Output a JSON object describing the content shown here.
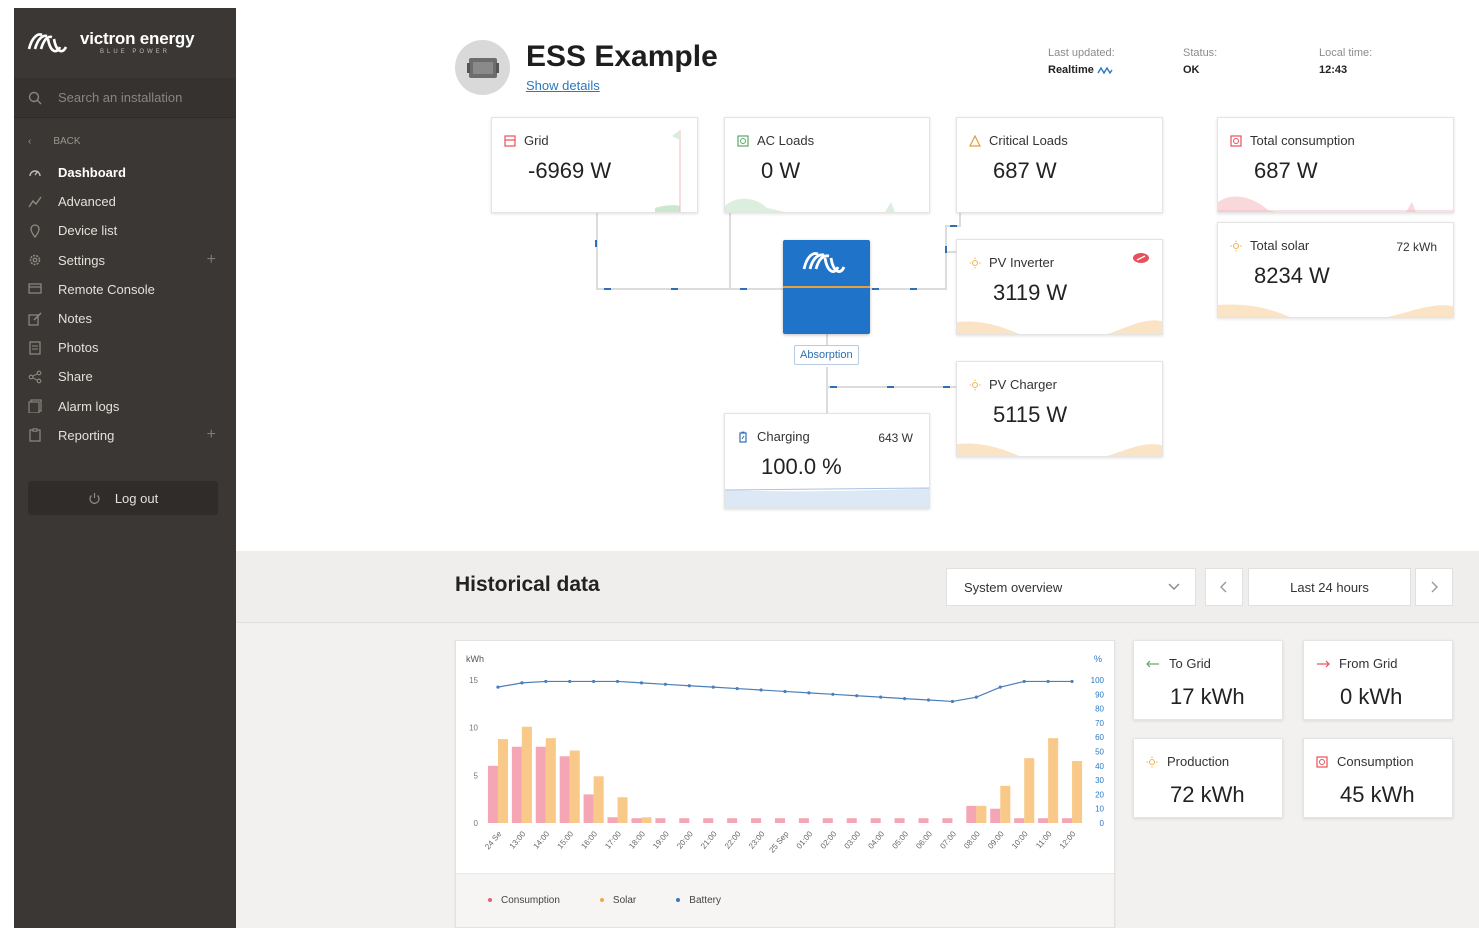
{
  "brand": {
    "name": "victron energy",
    "tagline": "BLUE POWER"
  },
  "sidebar": {
    "search_placeholder": "Search an installation",
    "back_label": "BACK",
    "items": [
      {
        "label": "Dashboard",
        "icon": "gauge-icon",
        "active": true
      },
      {
        "label": "Advanced",
        "icon": "graph-icon"
      },
      {
        "label": "Device list",
        "icon": "location-icon"
      },
      {
        "label": "Settings",
        "icon": "gear-icon",
        "expandable": true
      },
      {
        "label": "Remote Console",
        "icon": "console-icon"
      },
      {
        "label": "Notes",
        "icon": "edit-icon"
      },
      {
        "label": "Photos",
        "icon": "photo-icon"
      },
      {
        "label": "Share",
        "icon": "share-icon"
      },
      {
        "label": "Alarm logs",
        "icon": "alarm-icon"
      },
      {
        "label": "Reporting",
        "icon": "report-icon",
        "expandable": true
      }
    ],
    "logout_label": "Log out"
  },
  "header": {
    "title": "ESS Example",
    "show_details": "Show details",
    "last_updated_label": "Last updated:",
    "last_updated_value": "Realtime",
    "status_label": "Status:",
    "status_value": "OK",
    "local_time_label": "Local time:",
    "local_time_value": "12:43"
  },
  "tiles": {
    "grid": {
      "title": "Grid",
      "value": "-6969 W"
    },
    "ac_loads": {
      "title": "AC Loads",
      "value": "0 W"
    },
    "critical_loads": {
      "title": "Critical Loads",
      "value": "687 W"
    },
    "total_consumption": {
      "title": "Total consumption",
      "value": "687 W"
    },
    "pv_inverter": {
      "title": "PV Inverter",
      "value": "3119 W"
    },
    "total_solar": {
      "title": "Total solar",
      "value": "8234 W",
      "extra": "72 kWh"
    },
    "pv_charger": {
      "title": "PV Charger",
      "value": "5115 W"
    },
    "battery": {
      "title": "Charging",
      "value": "100.0 %",
      "extra": "643 W"
    },
    "inverter_state": "Absorption"
  },
  "historical": {
    "title": "Historical data",
    "view_select": "System overview",
    "period": "Last 24 hours",
    "stats": {
      "to_grid": {
        "title": "To Grid",
        "value": "17 kWh"
      },
      "from_grid": {
        "title": "From Grid",
        "value": "0 kWh"
      },
      "production": {
        "title": "Production",
        "value": "72 kWh"
      },
      "consumption": {
        "title": "Consumption",
        "value": "45 kWh"
      }
    }
  },
  "colors": {
    "sidebar": "#3a3734",
    "accent_blue": "#1f74c9",
    "consumption": "#f4a6b4",
    "solar": "#f9c98a",
    "battery": "#4a7fb8"
  },
  "chart_data": {
    "type": "bar",
    "ylabel": "kWh",
    "y2label": "%",
    "ylim": [
      0,
      15
    ],
    "y_ticks": [
      0,
      5,
      10,
      15
    ],
    "y2lim": [
      0,
      100
    ],
    "y2_ticks": [
      0,
      10,
      20,
      30,
      40,
      50,
      60,
      70,
      80,
      90,
      100
    ],
    "categories": [
      "24 Se",
      "13:00",
      "14:00",
      "15:00",
      "16:00",
      "17:00",
      "18:00",
      "19:00",
      "20:00",
      "21:00",
      "22:00",
      "23:00",
      "25 Sep",
      "01:00",
      "02:00",
      "03:00",
      "04:00",
      "05:00",
      "06:00",
      "07:00",
      "08:00",
      "09:00",
      "10:00",
      "11:00",
      "12:00"
    ],
    "series": [
      {
        "name": "Consumption",
        "axis": "left",
        "values": [
          6.0,
          8.0,
          8.0,
          7.0,
          3.0,
          0.6,
          0.5,
          0.5,
          0.5,
          0.5,
          0.5,
          0.5,
          0.5,
          0.5,
          0.5,
          0.5,
          0.5,
          0.5,
          0.5,
          0.5,
          1.8,
          1.5,
          0.5,
          0.5,
          0.5
        ]
      },
      {
        "name": "Solar",
        "axis": "left",
        "values": [
          8.8,
          10.1,
          8.9,
          7.6,
          4.9,
          2.7,
          0.6,
          0,
          0,
          0,
          0,
          0,
          0,
          0,
          0,
          0,
          0,
          0,
          0,
          0,
          1.8,
          3.9,
          6.8,
          8.9,
          6.5
        ]
      },
      {
        "name": "Battery",
        "axis": "right",
        "values": [
          95,
          98,
          99,
          99,
          99,
          99,
          98,
          97,
          96,
          95,
          94,
          93,
          92,
          91,
          90,
          89,
          88,
          87,
          86,
          85,
          88,
          95,
          99,
          99,
          99
        ]
      }
    ]
  }
}
